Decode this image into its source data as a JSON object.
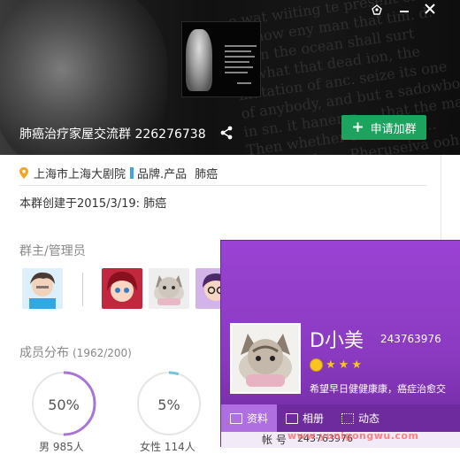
{
  "window": {
    "controls": [
      "skin-icon",
      "minimize-icon",
      "close-icon"
    ]
  },
  "group": {
    "name": "肺癌治疗家屋交流群",
    "id": "226276738",
    "join_label": "申请加群",
    "location": "上海市上海大剧院",
    "category": "品牌.产品",
    "tag": "肺癌",
    "created": "本群创建于2015/3/19:  肺癌"
  },
  "admins": {
    "title": "群主/管理员"
  },
  "members": {
    "title": "成员分布",
    "count": "(1962/200)",
    "stats": [
      {
        "percent_label": "50%",
        "fraction": 0.5,
        "label": "男  985人"
      },
      {
        "percent_label": "5%",
        "fraction": 0.05,
        "label": "女性  114人"
      }
    ]
  },
  "profile": {
    "name": "D小美",
    "number": "243763976",
    "signature": "希望早日健健康康，癌症治愈交",
    "tabs": [
      {
        "label": "资料",
        "icon": "id-card-icon"
      },
      {
        "label": "相册",
        "icon": "photo-icon"
      },
      {
        "label": "动态",
        "icon": "feed-icon"
      }
    ],
    "row_label": "帐    号",
    "row_value": "243763976"
  },
  "watermark": "www.yunigongwu.com",
  "colors": {
    "accent": "#1ca35d",
    "card": "#8e3bc4",
    "ring": "#a875d6"
  }
}
